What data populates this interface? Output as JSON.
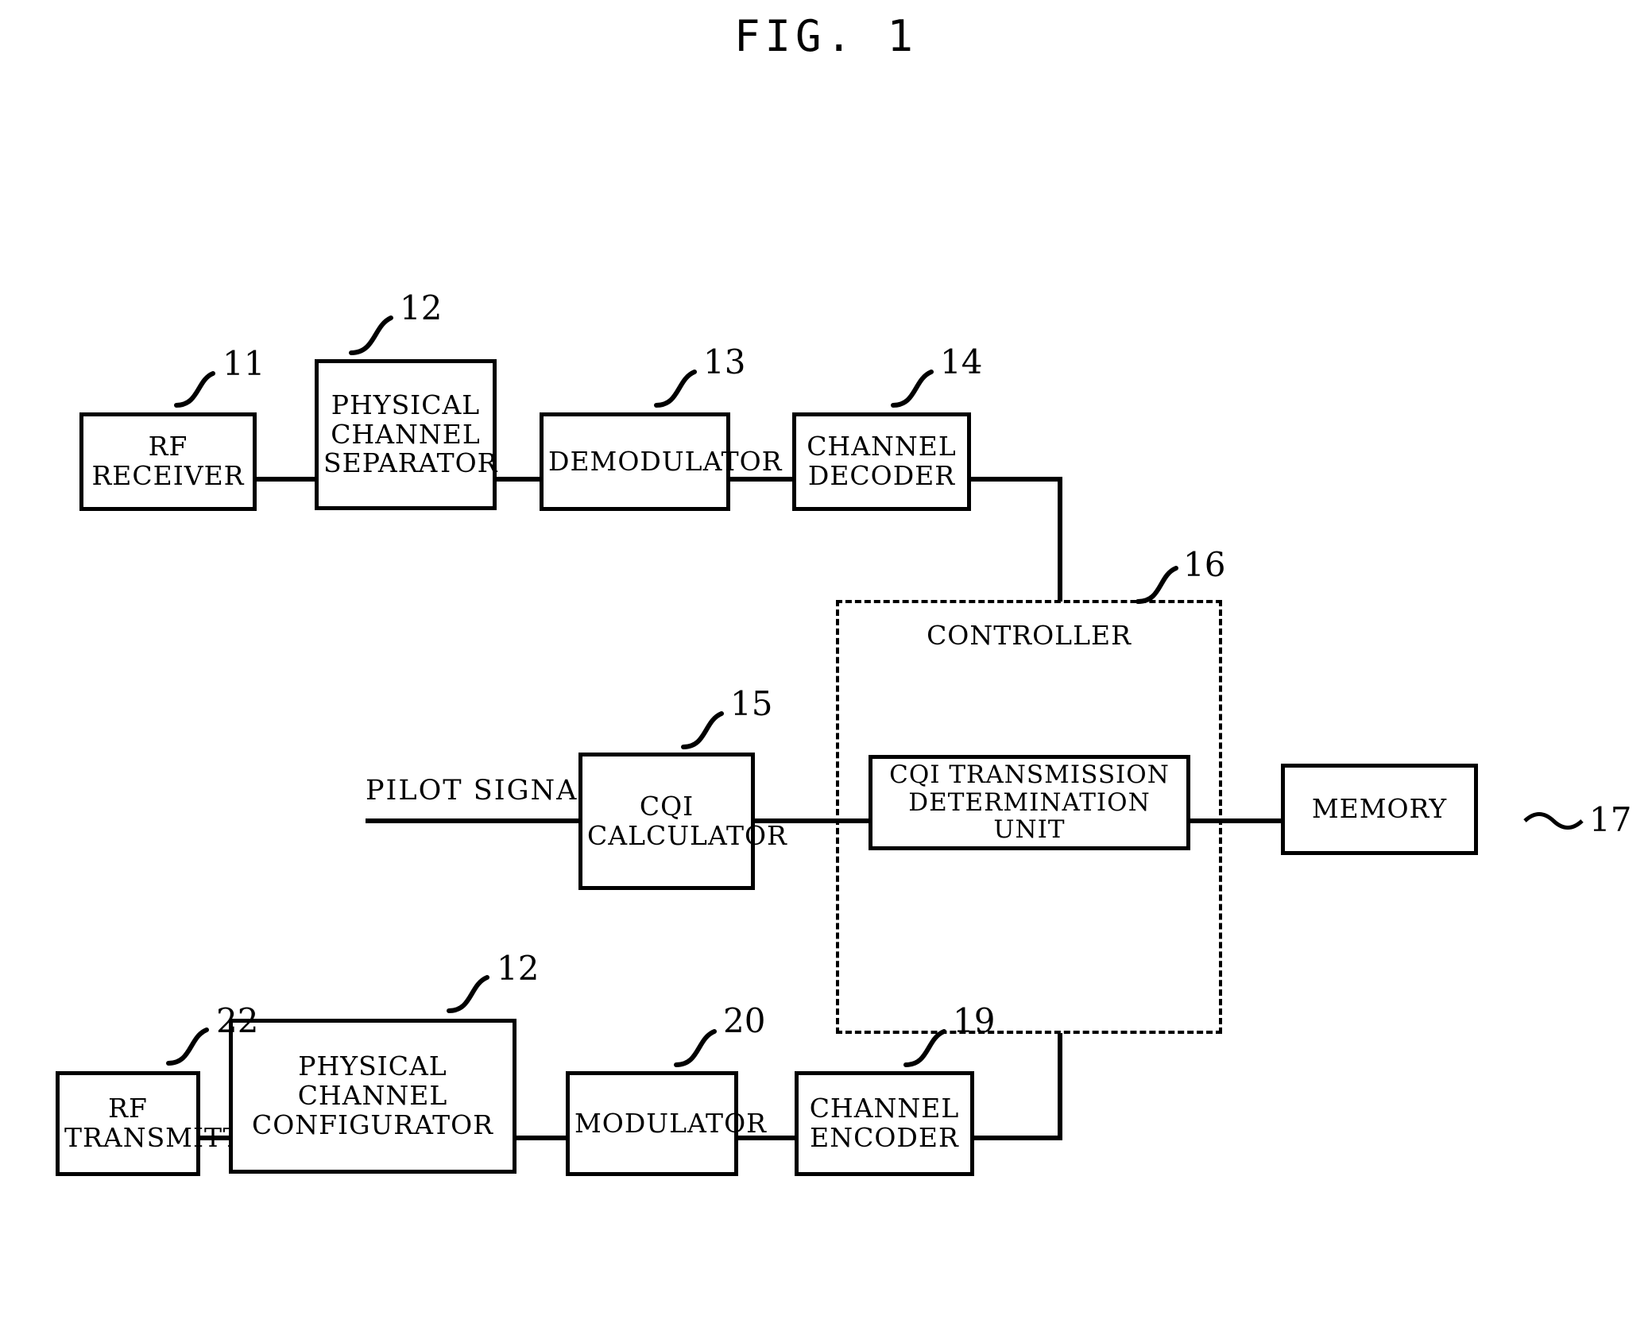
{
  "figure": {
    "title": "FIG. 1",
    "type": "patent-block-diagram"
  },
  "blocks": [
    {
      "id": "rf_receiver",
      "label": "RF\nRECEIVER",
      "ref": "11"
    },
    {
      "id": "phys_separator",
      "label": "PHYSICAL\nCHANNEL\nSEPARATOR",
      "ref": "12"
    },
    {
      "id": "demodulator",
      "label": "DEMODULATOR",
      "ref": "13"
    },
    {
      "id": "channel_decoder",
      "label": "CHANNEL\nDECODER",
      "ref": "14"
    },
    {
      "id": "cqi_calculator",
      "label": "CQI\nCALCULATOR",
      "ref": "15"
    },
    {
      "id": "cqi_determination",
      "label": "CQI TRANSMISSION\nDETERMINATION UNIT",
      "ref": ""
    },
    {
      "id": "memory",
      "label": "MEMORY",
      "ref": "17"
    },
    {
      "id": "rf_transmitter",
      "label": "RF\nTRANSMITTER",
      "ref": "22"
    },
    {
      "id": "phys_configurator",
      "label": "PHYSICAL\nCHANNEL\nCONFIGURATOR",
      "ref": "12"
    },
    {
      "id": "modulator",
      "label": "MODULATOR",
      "ref": "20"
    },
    {
      "id": "channel_encoder",
      "label": "CHANNEL\nENCODER",
      "ref": "19"
    }
  ],
  "controller": {
    "caption": "CONTROLLER",
    "ref": "16"
  },
  "free_labels": [
    {
      "id": "pilot_signal",
      "text": "PILOT SIGNAL"
    }
  ],
  "colors": {
    "ink": "#000000",
    "paper": "#ffffff"
  }
}
